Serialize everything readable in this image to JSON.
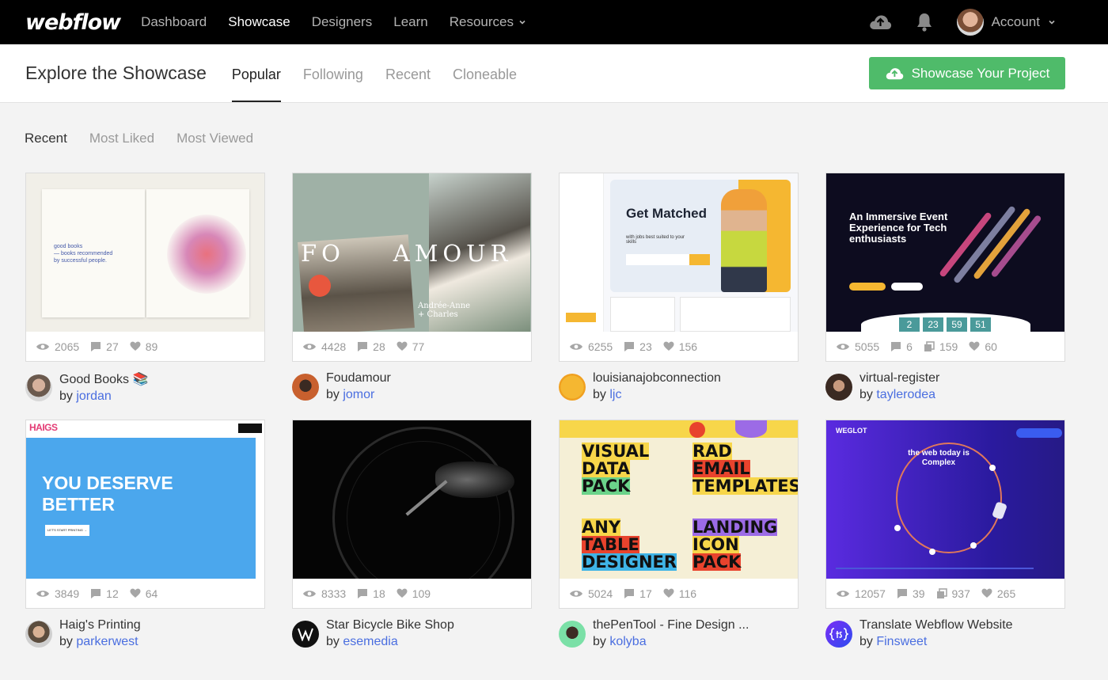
{
  "nav": {
    "logo": "webflow",
    "links": [
      {
        "label": "Dashboard",
        "active": false
      },
      {
        "label": "Showcase",
        "active": true
      },
      {
        "label": "Designers",
        "active": false
      },
      {
        "label": "Learn",
        "active": false
      },
      {
        "label": "Resources",
        "active": false
      }
    ],
    "account_label": "Account"
  },
  "subheader": {
    "title": "Explore the Showcase",
    "tabs": [
      {
        "label": "Popular",
        "active": true
      },
      {
        "label": "Following",
        "active": false
      },
      {
        "label": "Recent",
        "active": false
      },
      {
        "label": "Cloneable",
        "active": false
      }
    ],
    "cta_label": "Showcase Your Project"
  },
  "sort": {
    "options": [
      {
        "label": "Recent",
        "active": true
      },
      {
        "label": "Most Liked",
        "active": false
      },
      {
        "label": "Most Viewed",
        "active": false
      }
    ]
  },
  "colors": {
    "cta": "#4fbb6a",
    "link": "#4a6ee0",
    "nav_bg": "#000000"
  },
  "cards": [
    {
      "name": "Good Books 📚",
      "by": "by ",
      "author": "jordan",
      "views": "2065",
      "comments": "27",
      "clones": null,
      "likes": "89",
      "thumb": {
        "lines": [
          "good books",
          "— books recommended",
          "by successful people."
        ]
      }
    },
    {
      "name": "Foudamour",
      "by": "by ",
      "author": "jomor",
      "views": "4428",
      "comments": "28",
      "clones": null,
      "likes": "77",
      "thumb": {
        "headline": "FO    AMOUR",
        "caption": "Andrée-Anne\n+ Charles"
      }
    },
    {
      "name": "louisianajobconnection",
      "by": "by ",
      "author": "ljc",
      "views": "6255",
      "comments": "23",
      "clones": null,
      "likes": "156",
      "thumb": {
        "headline": "Get Matched",
        "sub": "with jobs best suited to your skills"
      }
    },
    {
      "name": "virtual-register",
      "by": "by ",
      "author": "taylerodea",
      "views": "5055",
      "comments": "6",
      "clones": "159",
      "likes": "60",
      "thumb": {
        "headline": "An Immersive Event Experience for Tech enthusiasts",
        "counters": [
          "2",
          "23",
          "59",
          "51"
        ]
      }
    },
    {
      "name": "Haig's Printing",
      "by": "by ",
      "author": "parkerwest",
      "views": "3849",
      "comments": "12",
      "clones": null,
      "likes": "64",
      "thumb": {
        "logo": "HAIGS",
        "headline": "YOU DESERVE BETTER",
        "button": "LET'S START PRINTING →"
      }
    },
    {
      "name": "Star Bicycle Bike Shop",
      "by": "by ",
      "author": "esemedia",
      "views": "8333",
      "comments": "18",
      "clones": null,
      "likes": "109",
      "thumb": {}
    },
    {
      "name": "thePenTool - Fine Design ...",
      "by": "by ",
      "author": "kolyba",
      "views": "5024",
      "comments": "17",
      "clones": null,
      "likes": "116",
      "thumb": {
        "words": [
          "VISUAL",
          "DATA",
          "PACK",
          "RAD",
          "EMAIL",
          "TEMPLATES",
          "ANY",
          "TABLE",
          "DESIGNER",
          "LANDING",
          "ICON",
          "PACK"
        ]
      }
    },
    {
      "name": "Translate Webflow Website",
      "by": "by ",
      "author": "Finsweet",
      "views": "12057",
      "comments": "39",
      "clones": "937",
      "likes": "265",
      "thumb": {
        "logo": "WEGLOT",
        "headline": "the web today is Complex"
      }
    }
  ]
}
